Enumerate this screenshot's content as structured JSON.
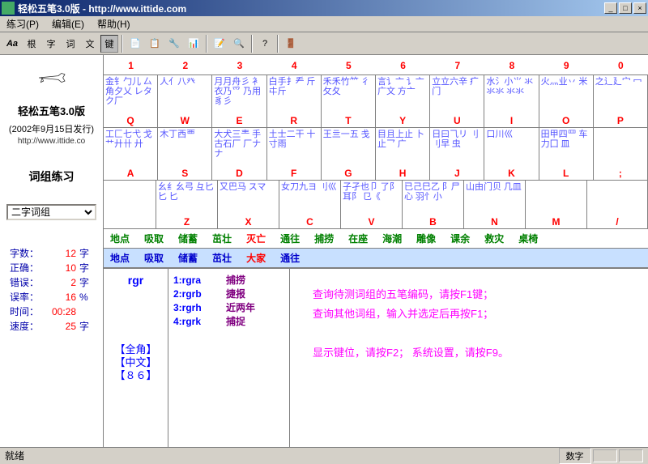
{
  "window": {
    "title": "轻松五笔3.0版 - http://www.ittide.com"
  },
  "menu": [
    "练习(P)",
    "编辑(E)",
    "帮助(H)"
  ],
  "toolbar_text": [
    "Aa",
    "根",
    "字",
    "词",
    "文",
    "键"
  ],
  "left": {
    "app_title": "轻松五笔3.0版",
    "app_sub": "(2002年9月15日发行)",
    "app_url": "http://www.ittide.co",
    "mode": "词组练习",
    "dropdown": "二字词组"
  },
  "stats": [
    {
      "label": "字数：",
      "val": "12",
      "unit": "字"
    },
    {
      "label": "正确：",
      "val": "10",
      "unit": "字"
    },
    {
      "label": "错误：",
      "val": "2",
      "unit": "字"
    },
    {
      "label": "误率：",
      "val": "16",
      "unit": "%"
    },
    {
      "label": "时间：",
      "val": "00:28",
      "unit": ""
    },
    {
      "label": "速度：",
      "val": "25",
      "unit": "字"
    }
  ],
  "numbers": [
    "1",
    "2",
    "3",
    "4",
    "5",
    "6",
    "7",
    "8",
    "9",
    "0"
  ],
  "keys_row1": [
    {
      "chars": "金钅勹儿\n厶角夕乂\nレタク厂",
      "letter": "Q"
    },
    {
      "chars": "人亻八癶",
      "letter": "W"
    },
    {
      "chars": "月月舟彡\n衤衣乃爫\n乃用豸彡",
      "letter": "E"
    },
    {
      "chars": "白手扌龵\n斤㐄斤",
      "letter": "R"
    },
    {
      "chars": "禾禾竹⺮\n彳攵夂",
      "letter": "T"
    },
    {
      "chars": "言讠亠\n讠亠广文\n方亠",
      "letter": "Y"
    },
    {
      "chars": "立立六辛\n疒门",
      "letter": "U"
    },
    {
      "chars": "水氵小⺌\n氺氺氺\n氺氺",
      "letter": "I"
    },
    {
      "chars": "火灬业丷\n米",
      "letter": "O"
    },
    {
      "chars": "之辶廴宀\n冖",
      "letter": "P"
    }
  ],
  "keys_row2": [
    {
      "chars": "工匚七弋\n戈艹廾卄\n廾",
      "letter": "A"
    },
    {
      "chars": "木丁西覀",
      "letter": "S"
    },
    {
      "chars": "大犬三龶\n手古石厂\n厂ナナ",
      "letter": "D"
    },
    {
      "chars": "土士二干\n十寸雨",
      "letter": "F"
    },
    {
      "chars": "王亖一五\n戋",
      "letter": "G"
    },
    {
      "chars": "目且上止\n卜止乛\n广",
      "letter": "H"
    },
    {
      "chars": "日曰⺄リ\n刂刂早\n虫",
      "letter": "J"
    },
    {
      "chars": "口川巛",
      "letter": "K"
    },
    {
      "chars": "田甲四罒\n车力囗\n皿",
      "letter": "L"
    },
    {
      "chars": "",
      "letter": ";"
    }
  ],
  "keys_row3": [
    {
      "chars": "",
      "letter": ""
    },
    {
      "chars": "幺纟幺弓\n彑匕匕\n匕",
      "letter": "Z"
    },
    {
      "chars": "又巴马\nスマ",
      "letter": "X"
    },
    {
      "chars": "女刀九ヨ\n刂巛",
      "letter": "C"
    },
    {
      "chars": "子孑也卩\n了阝耳阝\n㔾《",
      "letter": "V"
    },
    {
      "chars": "已己巳乙\n阝尸心\n羽忄小",
      "letter": "B"
    },
    {
      "chars": "山由门贝\n几皿",
      "letter": "N"
    },
    {
      "chars": "",
      "letter": "M"
    },
    {
      "chars": "",
      "letter": "/"
    }
  ],
  "words_green": [
    "地点",
    "吸取",
    "储蓄",
    "茁壮",
    "灭亡",
    "通往",
    "捕捞",
    "在座",
    "海潮",
    "雕像",
    "课余",
    "救灾",
    "桌椅"
  ],
  "words_green_red_idx": 4,
  "words_blue": [
    "地点",
    "吸取",
    "储蓄",
    "茁壮",
    "大家",
    "通往"
  ],
  "words_blue_red_idx": 4,
  "input_code": "rgr",
  "status_indicators": [
    "【全角】",
    "【中文】",
    "【８６】"
  ],
  "candidates": [
    {
      "code": "1:rgra",
      "word": "捕捞"
    },
    {
      "code": "2:rgrb",
      "word": "捷报"
    },
    {
      "code": "3:rgrh",
      "word": "近两年"
    },
    {
      "code": "4:rgrk",
      "word": "捕捉"
    }
  ],
  "help_lines": [
    "查询待测词组的五笔编码，请按F1键；",
    "查询其他词组，输入并选定后再按F1；",
    "",
    "显示键位，请按F2； 系统设置，请按F9。"
  ],
  "statusbar": {
    "left": "就绪",
    "right": "数字"
  }
}
